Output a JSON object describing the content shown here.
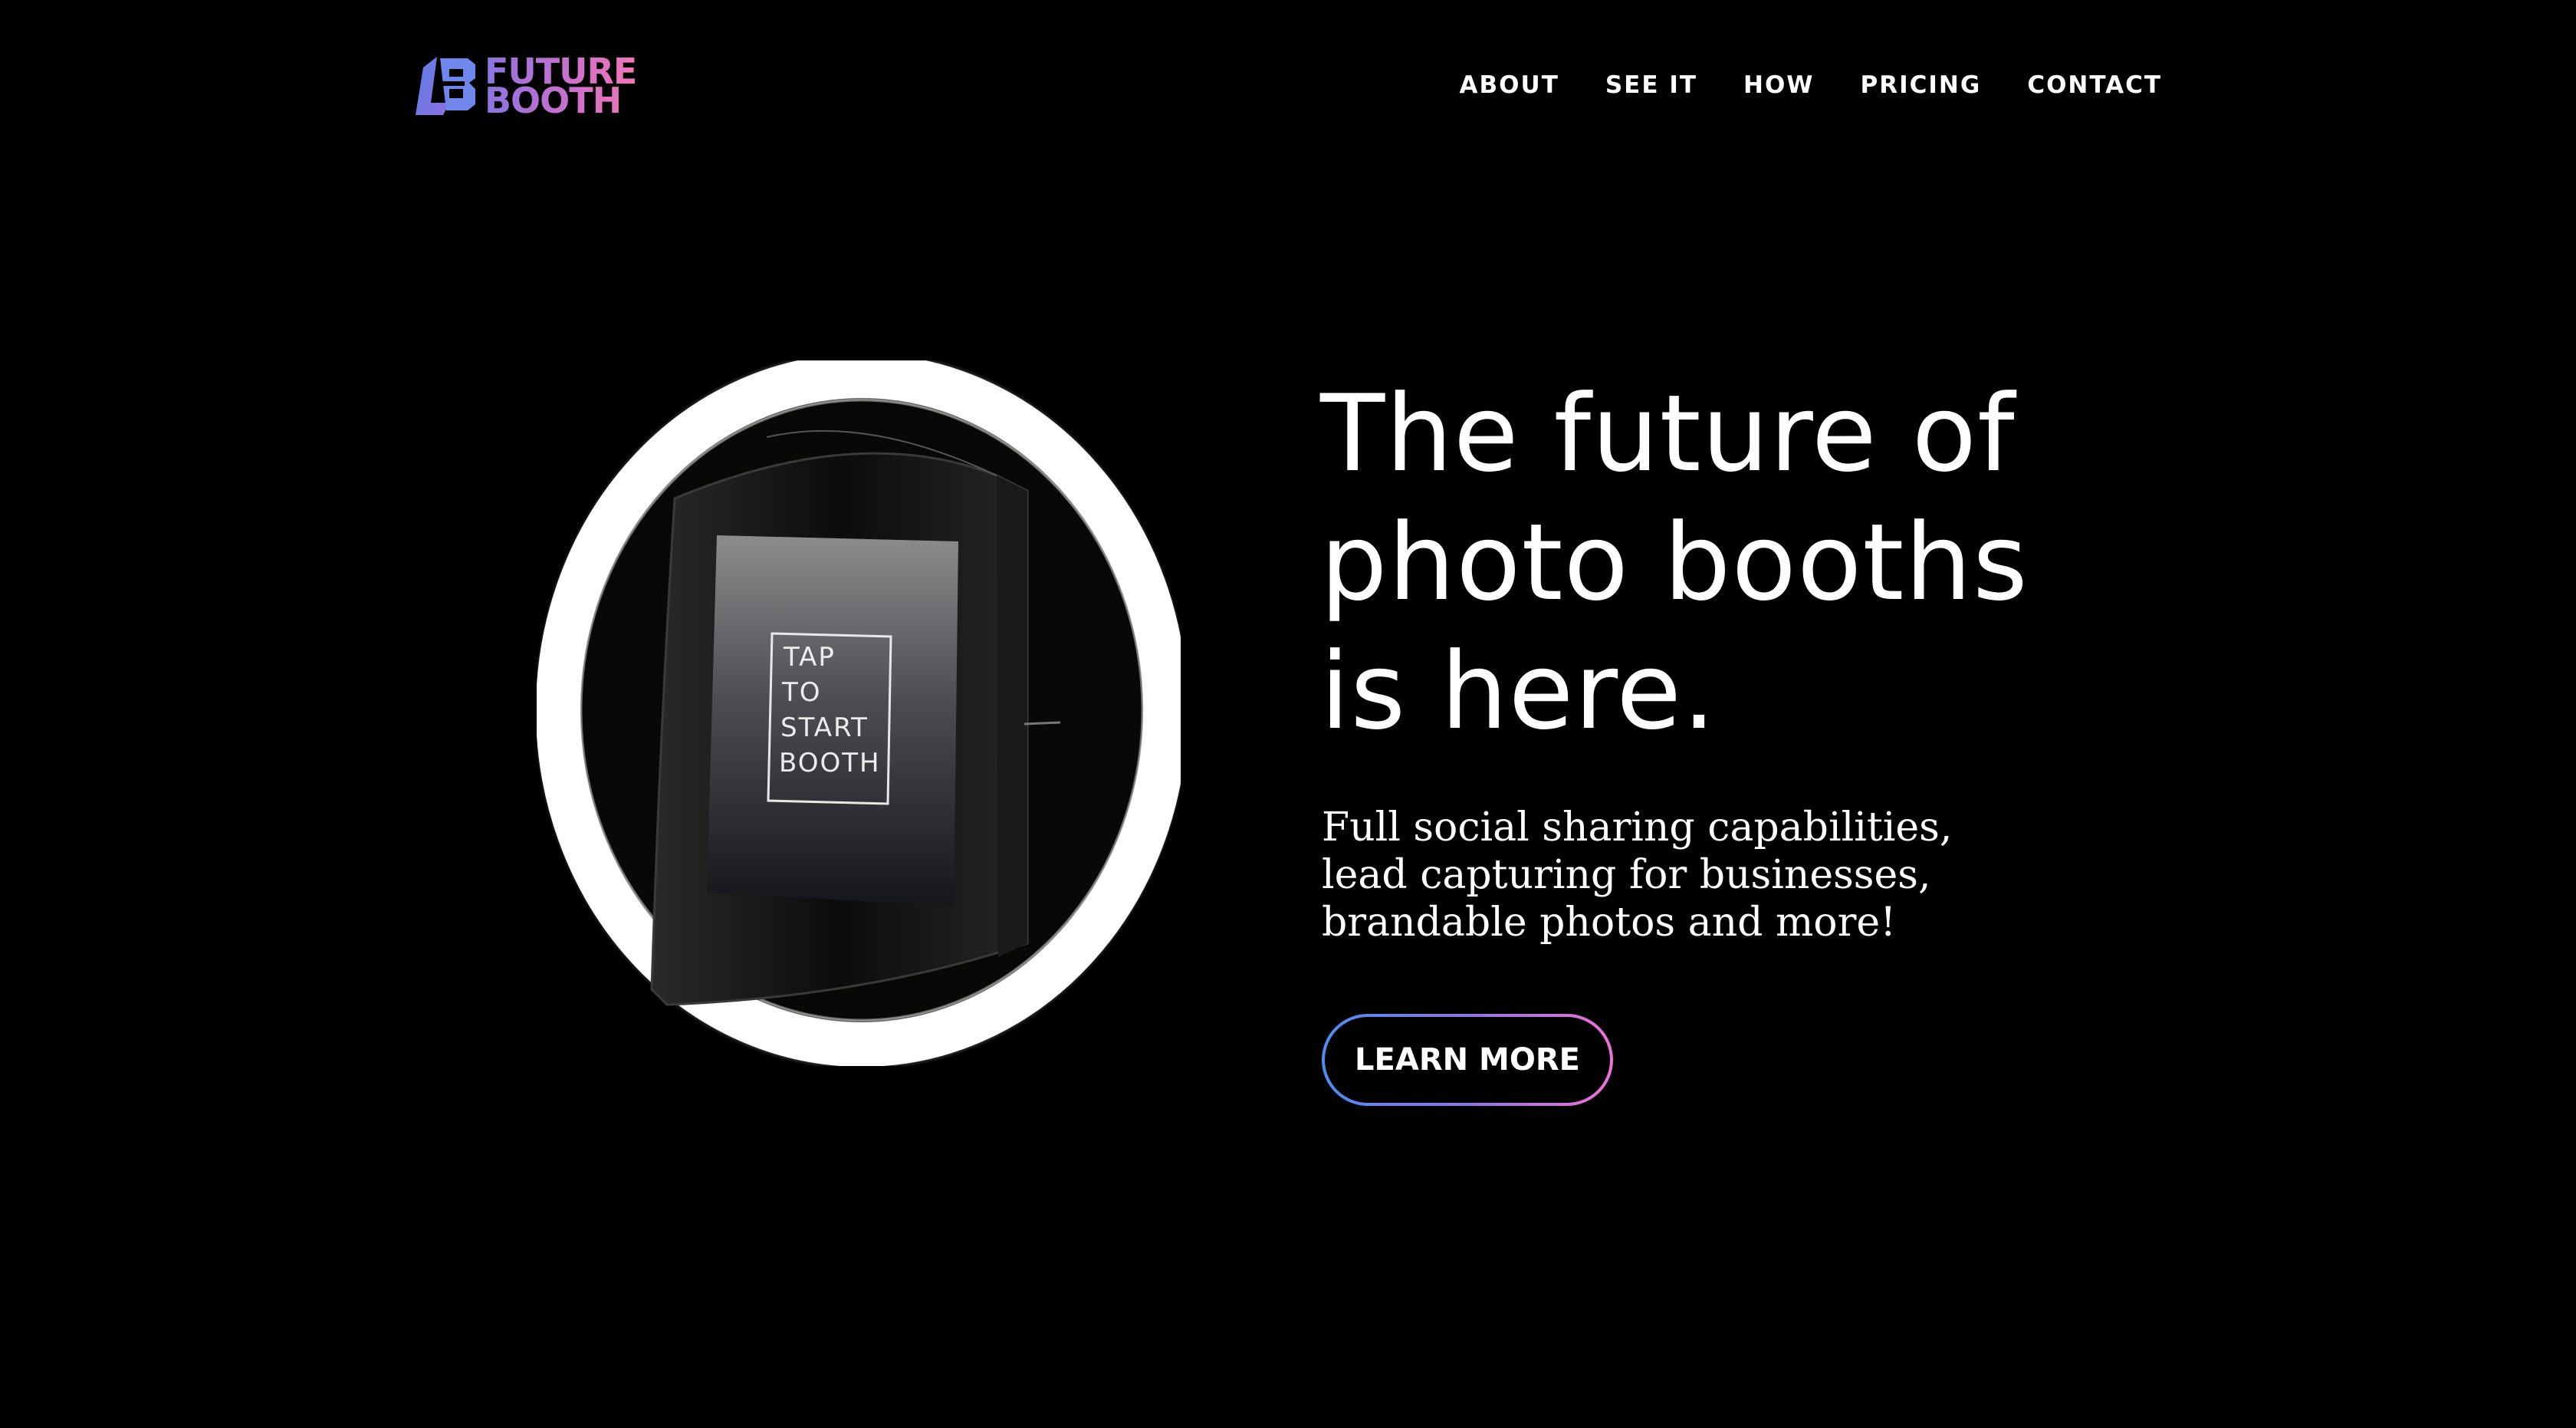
{
  "brand": {
    "name_line1": "FUTURE",
    "name_line2": "BOOTH",
    "logo_icon": "fb-monogram-icon",
    "gradient_start": "#8a74e0",
    "gradient_end": "#f276b6"
  },
  "nav": {
    "items": [
      {
        "label": "ABOUT"
      },
      {
        "label": "SEE IT"
      },
      {
        "label": "HOW"
      },
      {
        "label": "PRICING"
      },
      {
        "label": "CONTACT"
      }
    ]
  },
  "hero": {
    "title_line1": "The future of",
    "title_line2": "photo booths",
    "title_line3": "is here.",
    "subtitle": "Full social sharing capabilities, lead capturing for businesses, brandable photos and more!",
    "cta_label": "LEARN MORE",
    "cta_gradient_start": "#4c8df0",
    "cta_gradient_end": "#ee72d6",
    "image": {
      "screen_text_line1": "TAP",
      "screen_text_line2": "TO",
      "screen_text_line3": "START",
      "screen_text_line4": "BOOTH"
    }
  },
  "colors": {
    "background": "#000000",
    "text": "#ffffff"
  }
}
